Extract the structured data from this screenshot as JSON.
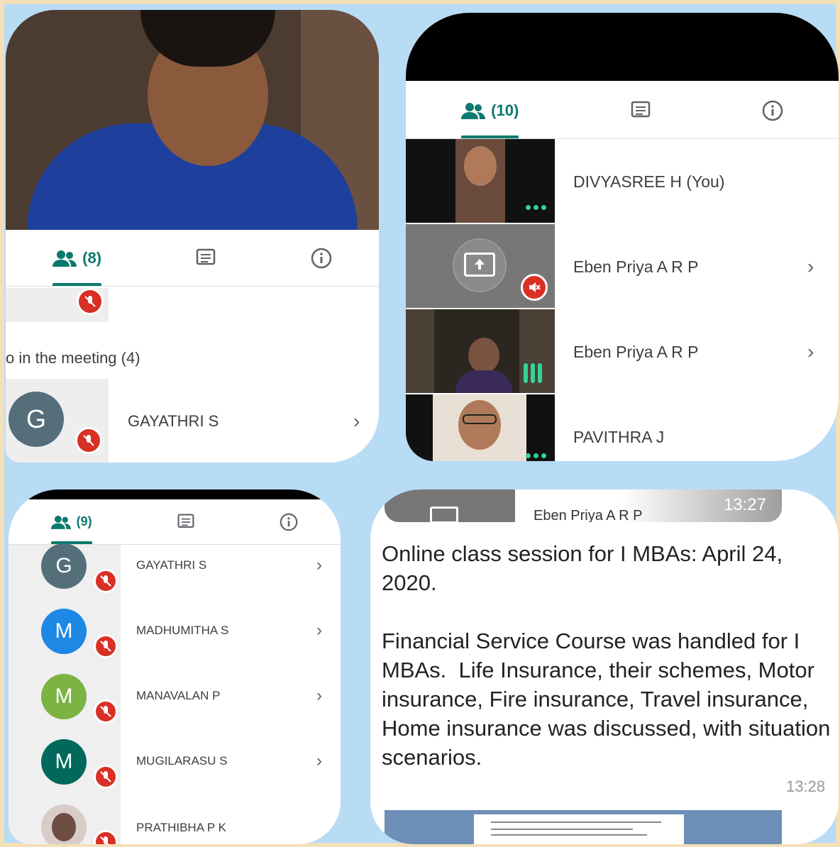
{
  "panel1": {
    "tabs": {
      "participants_count": "(8)"
    },
    "section_header": "o in the meeting (4)",
    "participant": {
      "initial": "G",
      "name": "GAYATHRI S"
    }
  },
  "panel2": {
    "tabs": {
      "participants_count": "(10)"
    },
    "participants": [
      {
        "name": "DIVYASREE H (You)"
      },
      {
        "name": "Eben Priya A R P"
      },
      {
        "name": "Eben Priya A R P"
      },
      {
        "name": "PAVITHRA J"
      }
    ]
  },
  "panel3": {
    "tabs": {
      "participants_count": "(9)"
    },
    "participants": [
      {
        "initial": "G",
        "name": "GAYATHRI S",
        "color": "#546e7a"
      },
      {
        "initial": "M",
        "name": "MADHUMITHA S",
        "color": "#1e88e5"
      },
      {
        "initial": "M",
        "name": "MANAVALAN P",
        "color": "#7cb342"
      },
      {
        "initial": "M",
        "name": "MUGILARASU S",
        "color": "#00695c"
      },
      {
        "initial": "",
        "name": "PRATHIBHA P K",
        "color": "#d7ccc8"
      }
    ]
  },
  "panel4": {
    "notification": {
      "name": "Eben Priya A R P",
      "time": "13:27"
    },
    "message": "Online class session for I MBAs: April 24, 2020.\n\nFinancial Service Course was handled for I MBAs.  Life Insurance, their schemes, Motor insurance, Fire insurance, Travel insurance, Home insurance was discussed, with situation scenarios.",
    "time": "13:28"
  },
  "colors": {
    "accent": "#0b7a6e",
    "mic_off": "#d93025",
    "background": "#b9dcf5"
  }
}
